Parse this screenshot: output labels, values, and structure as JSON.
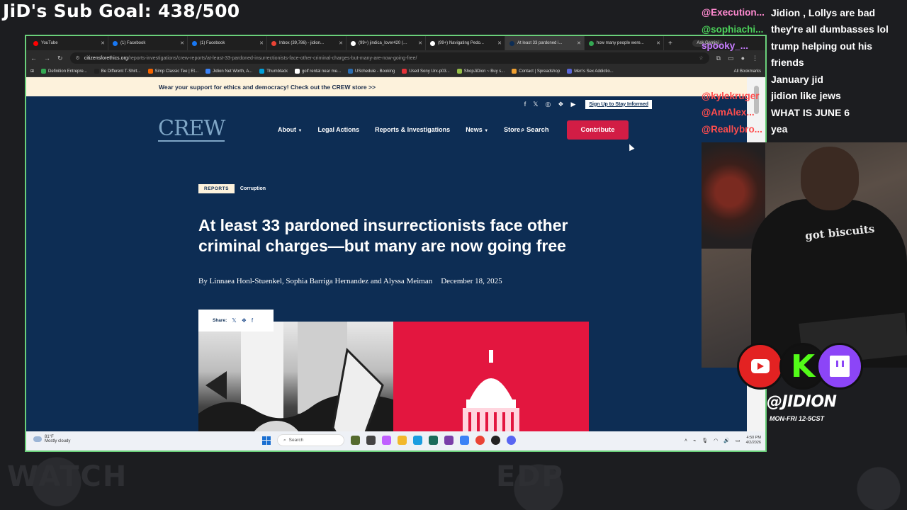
{
  "overlay": {
    "sub_goal": "JiD's Sub Goal: 438/500",
    "handle": "@JIDION",
    "schedule": "MON-FRI 12-5CST",
    "watermark": "EDP WATCH"
  },
  "chat": [
    {
      "user": "@Execution...",
      "message": "Jidion , Lollys are bad",
      "color": "#ff8ad0"
    },
    {
      "user": "@sophiachi...",
      "message": "they're all dumbasses lol",
      "color": "#4bd35a"
    },
    {
      "user": "spooky_...",
      "message": "trump helping out his",
      "color": "#c77dff"
    },
    {
      "user": "",
      "message": "friends",
      "color": "#ffffff"
    },
    {
      "user": "",
      "message": "January jid",
      "color": "#ffffff"
    },
    {
      "user": "@kylekruger",
      "message": "jidion like jews",
      "color": "#ff4d4d"
    },
    {
      "user": "@AmAlex...",
      "message": "WHAT IS JUNE 6",
      "color": "#ff4d4d"
    },
    {
      "user": "@Reallybro...",
      "message": "yea",
      "color": "#ff4d4d"
    }
  ],
  "browser": {
    "tabs": [
      {
        "label": "YouTube",
        "color": "#ff0000"
      },
      {
        "label": "(1) Facebook",
        "color": "#1877f2"
      },
      {
        "label": "(1) Facebook",
        "color": "#1877f2"
      },
      {
        "label": "Inbox (39,786) - jidion...",
        "color": "#ea4335"
      },
      {
        "label": "(99+) jindica_lover420 (…",
        "color": "#ffffff"
      },
      {
        "label": "(99+) Navigating Pedo...",
        "color": "#ffffff"
      },
      {
        "label": "At least 33 pardoned i...",
        "color": "#0d2d54",
        "active": true
      },
      {
        "label": "how many people were...",
        "color": "#34a853"
      }
    ],
    "ask_gemini": "Ask Gemini",
    "url_domain": "citizensforethics.org",
    "url_path": "/reports-investigations/crew-reports/at-least-33-pardoned-insurrectionists-face-other-criminal-charges-but-many-are-now-going-free/",
    "bookmarks": [
      {
        "label": "Definition Entrepre...",
        "color": "#34a853"
      },
      {
        "label": "Be Different T-Shirt...",
        "color": "#222222"
      },
      {
        "label": "Simp Classic Tee | Et...",
        "color": "#f56400"
      },
      {
        "label": "Jidion Net Worth, A...",
        "color": "#3b82f6"
      },
      {
        "label": "Thumbtack",
        "color": "#009fd9"
      },
      {
        "label": "golf rental near me...",
        "color": "#ffffff"
      },
      {
        "label": "USchedule - Booking",
        "color": "#2b6cb0"
      },
      {
        "label": "Used Sony Urx-p03...",
        "color": "#e53238"
      },
      {
        "label": "ShopJiDion ~ Buy s...",
        "color": "#96bf48"
      },
      {
        "label": "Contact | Spreadshop",
        "color": "#f0a030"
      },
      {
        "label": "Men's Sex Addictio...",
        "color": "#5a67d8"
      }
    ],
    "all_bookmarks": "All Bookmarks"
  },
  "site": {
    "promo": "Wear your support for ethics and democracy! Check out the CREW store >>",
    "signup": "Sign Up to Stay Informed",
    "logo": "CREW",
    "nav": [
      "About",
      "Legal Actions",
      "Reports & Investigations",
      "News",
      "Store"
    ],
    "search": "Search",
    "contribute": "Contribute",
    "tag": "REPORTS",
    "category": "Corruption",
    "headline": "At least 33 pardoned insurrectionists face other criminal charges—but many are now going free",
    "authors": "By Linnaea Honl-Stuenkel, Sophia Barriga Hernandez and Alyssa Meiman",
    "date": "December 18, 2025",
    "share_label": "Share:"
  },
  "taskbar": {
    "temp": "81°F",
    "weather": "Mostly cloudy",
    "search": "Search",
    "time": "4:50 PM",
    "date": "4/2/2026"
  }
}
